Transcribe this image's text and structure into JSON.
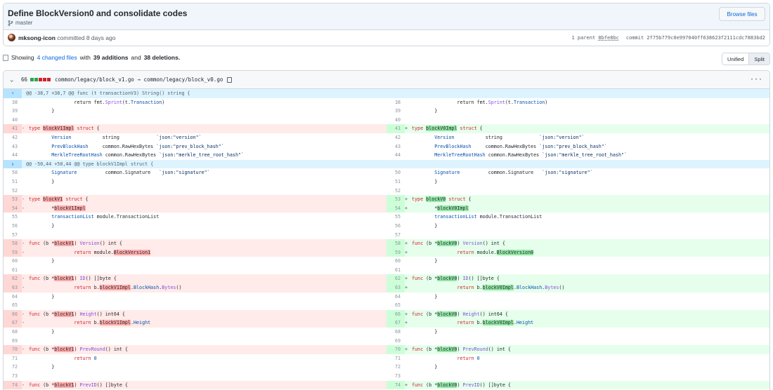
{
  "commit": {
    "title": "Define BlockVersion0 and consolidate codes",
    "branch": "master",
    "browse_label": "Browse files",
    "author": "mksong-icon",
    "committed_text": "committed 8 days ago",
    "parent_label": "1 parent",
    "parent_sha": "8bfe8bc",
    "commit_label": "commit",
    "commit_sha": "2f75b779c0e997040ff638623f2111cdc7883bd2"
  },
  "summary": {
    "showing": "Showing",
    "changed_files": "4 changed files",
    "with": "with",
    "additions": "39 additions",
    "and": "and",
    "deletions": "38 deletions."
  },
  "view_toggle": {
    "unified": "Unified",
    "split": "Split",
    "active": "Split"
  },
  "file": {
    "change_count": "66",
    "diffstat": [
      "add",
      "add",
      "del",
      "del",
      "del"
    ],
    "path": "common/legacy/block_v1.go → common/legacy/block_v0.go",
    "colors": {
      "add": "#2da44e",
      "del": "#cf222e",
      "neutral": "#d0d7de"
    }
  },
  "diff": [
    {
      "type": "hunk",
      "text": "@@ -38,7 +38,7 @@ func (t transactionV3) String() string {",
      "icon": "expand-up-icon"
    },
    {
      "type": "ctx",
      "l": "38",
      "r": "38",
      "code": [
        [
          "\t\t"
        ],
        [
          "return fmt."
        ],
        [
          "Sprint",
          "f"
        ],
        [
          "(t."
        ],
        [
          "Transaction",
          "t"
        ],
        [
          ")"
        ]
      ]
    },
    {
      "type": "ctx",
      "l": "39",
      "r": "39",
      "code": [
        [
          "\t}"
        ]
      ]
    },
    {
      "type": "ctx",
      "l": "40",
      "r": "40",
      "code": [
        [
          ""
        ]
      ]
    },
    {
      "type": "chg",
      "l": "41",
      "r": "41",
      "lcode": [
        [
          "type ",
          "k"
        ],
        [
          "blockV1Impl",
          "hd"
        ],
        [
          " struct ",
          "k"
        ],
        [
          "{"
        ]
      ],
      "rcode": [
        [
          "type ",
          "k"
        ],
        [
          "blockV0Impl",
          "ha"
        ],
        [
          " struct ",
          "k"
        ],
        [
          "{"
        ]
      ]
    },
    {
      "type": "ctx",
      "l": "42",
      "r": "42",
      "code": [
        [
          "\t"
        ],
        [
          "Version",
          "t"
        ],
        [
          "           string             "
        ],
        [
          "`json:\"version\"`",
          "s"
        ]
      ]
    },
    {
      "type": "ctx",
      "l": "43",
      "r": "43",
      "code": [
        [
          "\t"
        ],
        [
          "PrevBlockHash",
          "t"
        ],
        [
          "     common.RawHexBytes "
        ],
        [
          "`json:\"prev_block_hash\"`",
          "s"
        ]
      ]
    },
    {
      "type": "ctx",
      "l": "44",
      "r": "44",
      "code": [
        [
          "\t"
        ],
        [
          "MerkleTreeRootHash",
          "t"
        ],
        [
          " common.RawHexBytes "
        ],
        [
          "`json:\"merkle_tree_root_hash\"`",
          "s"
        ]
      ]
    },
    {
      "type": "hunk",
      "text": "@@ -50,44 +50,44 @@ type blockV1Impl struct {",
      "icon": "expand-both-icon"
    },
    {
      "type": "ctx",
      "l": "50",
      "r": "50",
      "code": [
        [
          "\t"
        ],
        [
          "Signature",
          "t"
        ],
        [
          "          common.Signature   "
        ],
        [
          "`json:\"signature\"`",
          "s"
        ]
      ]
    },
    {
      "type": "ctx",
      "l": "51",
      "r": "51",
      "code": [
        [
          "\t}"
        ]
      ]
    },
    {
      "type": "ctx",
      "l": "52",
      "r": "52",
      "code": [
        [
          ""
        ]
      ]
    },
    {
      "type": "chg",
      "l": "53",
      "r": "53",
      "lcode": [
        [
          "type ",
          "k"
        ],
        [
          "blockV1",
          "hd"
        ],
        [
          " struct ",
          "k"
        ],
        [
          "{"
        ]
      ],
      "rcode": [
        [
          "type ",
          "k"
        ],
        [
          "blockV0",
          "ha"
        ],
        [
          " struct ",
          "k"
        ],
        [
          "{"
        ]
      ]
    },
    {
      "type": "chg",
      "l": "54",
      "r": "54",
      "lcode": [
        [
          "\t*"
        ],
        [
          "blockV1Impl",
          "hd"
        ]
      ],
      "rcode": [
        [
          "\t*"
        ],
        [
          "blockV0Impl",
          "ha"
        ]
      ]
    },
    {
      "type": "ctx",
      "l": "55",
      "r": "55",
      "code": [
        [
          "\t"
        ],
        [
          "transactionList",
          "t"
        ],
        [
          " module.TransactionList"
        ]
      ]
    },
    {
      "type": "ctx",
      "l": "56",
      "r": "56",
      "code": [
        [
          "\t}"
        ]
      ]
    },
    {
      "type": "ctx",
      "l": "57",
      "r": "57",
      "code": [
        [
          ""
        ]
      ]
    },
    {
      "type": "chg",
      "l": "58",
      "r": "58",
      "lcode": [
        [
          "func ",
          "k"
        ],
        [
          "(b *"
        ],
        [
          "blockV1",
          "hd"
        ],
        [
          ") "
        ],
        [
          "Version",
          "f"
        ],
        [
          "() int {"
        ]
      ],
      "rcode": [
        [
          "func ",
          "k"
        ],
        [
          "(b *"
        ],
        [
          "blockV0",
          "ha"
        ],
        [
          ") "
        ],
        [
          "Version",
          "f"
        ],
        [
          "() int {"
        ]
      ]
    },
    {
      "type": "chg",
      "l": "59",
      "r": "59",
      "lcode": [
        [
          "\t\t"
        ],
        [
          "return ",
          "k"
        ],
        [
          "module."
        ],
        [
          "BlockVersion1",
          "hd"
        ]
      ],
      "rcode": [
        [
          "\t\t"
        ],
        [
          "return ",
          "k"
        ],
        [
          "module."
        ],
        [
          "BlockVersion0",
          "ha"
        ]
      ]
    },
    {
      "type": "ctx",
      "l": "60",
      "r": "60",
      "code": [
        [
          "\t}"
        ]
      ]
    },
    {
      "type": "ctx",
      "l": "61",
      "r": "61",
      "code": [
        [
          ""
        ]
      ]
    },
    {
      "type": "chg",
      "l": "62",
      "r": "62",
      "lcode": [
        [
          "func ",
          "k"
        ],
        [
          "(b *"
        ],
        [
          "blockV1",
          "hd"
        ],
        [
          ") "
        ],
        [
          "ID",
          "f"
        ],
        [
          "() []byte {"
        ]
      ],
      "rcode": [
        [
          "func ",
          "k"
        ],
        [
          "(b *"
        ],
        [
          "blockV0",
          "ha"
        ],
        [
          ") "
        ],
        [
          "ID",
          "f"
        ],
        [
          "() []byte {"
        ]
      ]
    },
    {
      "type": "chg",
      "l": "63",
      "r": "63",
      "lcode": [
        [
          "\t\t"
        ],
        [
          "return ",
          "k"
        ],
        [
          "b."
        ],
        [
          "blockV1Impl",
          "hd"
        ],
        [
          "."
        ],
        [
          "BlockHash",
          "t"
        ],
        [
          "."
        ],
        [
          "Bytes",
          "f"
        ],
        [
          "()"
        ]
      ],
      "rcode": [
        [
          "\t\t"
        ],
        [
          "return ",
          "k"
        ],
        [
          "b."
        ],
        [
          "blockV0Impl",
          "ha"
        ],
        [
          "."
        ],
        [
          "BlockHash",
          "t"
        ],
        [
          "."
        ],
        [
          "Bytes",
          "f"
        ],
        [
          "()"
        ]
      ]
    },
    {
      "type": "ctx",
      "l": "64",
      "r": "64",
      "code": [
        [
          "\t}"
        ]
      ]
    },
    {
      "type": "ctx",
      "l": "65",
      "r": "65",
      "code": [
        [
          ""
        ]
      ]
    },
    {
      "type": "chg",
      "l": "66",
      "r": "66",
      "lcode": [
        [
          "func ",
          "k"
        ],
        [
          "(b *"
        ],
        [
          "blockV1",
          "hd"
        ],
        [
          ") "
        ],
        [
          "Height",
          "f"
        ],
        [
          "() int64 {"
        ]
      ],
      "rcode": [
        [
          "func ",
          "k"
        ],
        [
          "(b *"
        ],
        [
          "blockV0",
          "ha"
        ],
        [
          ") "
        ],
        [
          "Height",
          "f"
        ],
        [
          "() int64 {"
        ]
      ]
    },
    {
      "type": "chg",
      "l": "67",
      "r": "67",
      "lcode": [
        [
          "\t\t"
        ],
        [
          "return ",
          "k"
        ],
        [
          "b."
        ],
        [
          "blockV1Impl",
          "hd"
        ],
        [
          "."
        ],
        [
          "Height",
          "t"
        ]
      ],
      "rcode": [
        [
          "\t\t"
        ],
        [
          "return ",
          "k"
        ],
        [
          "b."
        ],
        [
          "blockV0Impl",
          "ha"
        ],
        [
          "."
        ],
        [
          "Height",
          "t"
        ]
      ]
    },
    {
      "type": "ctx",
      "l": "68",
      "r": "68",
      "code": [
        [
          "\t}"
        ]
      ]
    },
    {
      "type": "ctx",
      "l": "69",
      "r": "69",
      "code": [
        [
          ""
        ]
      ]
    },
    {
      "type": "chg",
      "l": "70",
      "r": "70",
      "lcode": [
        [
          "func ",
          "k"
        ],
        [
          "(b *"
        ],
        [
          "blockV1",
          "hd"
        ],
        [
          ") "
        ],
        [
          "PrevRound",
          "f"
        ],
        [
          "() int {"
        ]
      ],
      "rcode": [
        [
          "func ",
          "k"
        ],
        [
          "(b *"
        ],
        [
          "blockV0",
          "ha"
        ],
        [
          ") "
        ],
        [
          "PrevRound",
          "f"
        ],
        [
          "() int {"
        ]
      ]
    },
    {
      "type": "ctx",
      "l": "71",
      "r": "71",
      "code": [
        [
          "\t\t"
        ],
        [
          "return ",
          "k"
        ],
        [
          "0",
          "n"
        ]
      ]
    },
    {
      "type": "ctx",
      "l": "72",
      "r": "72",
      "code": [
        [
          "\t}"
        ]
      ]
    },
    {
      "type": "ctx",
      "l": "73",
      "r": "73",
      "code": [
        [
          ""
        ]
      ]
    },
    {
      "type": "chg",
      "l": "74",
      "r": "74",
      "lcode": [
        [
          "func ",
          "k"
        ],
        [
          "(b *"
        ],
        [
          "blockV1",
          "hd"
        ],
        [
          ") "
        ],
        [
          "PrevID",
          "f"
        ],
        [
          "() []byte {"
        ]
      ],
      "rcode": [
        [
          "func ",
          "k"
        ],
        [
          "(b *"
        ],
        [
          "blockV0",
          "ha"
        ],
        [
          ") "
        ],
        [
          "PrevID",
          "f"
        ],
        [
          "() []byte {"
        ]
      ]
    }
  ]
}
